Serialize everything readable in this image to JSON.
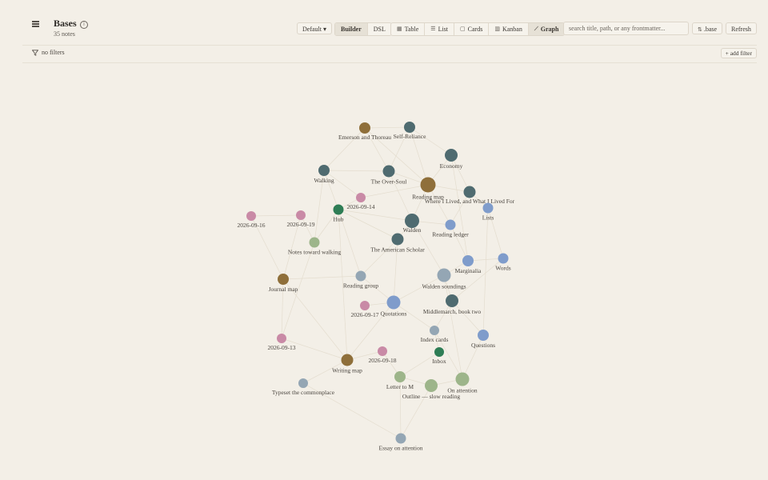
{
  "header": {
    "title": "Bases",
    "note_count": "35 notes"
  },
  "toolbar": {
    "preset_label": "Default ▾",
    "mode_tabs": [
      "Builder",
      "DSL"
    ],
    "active_mode": "Builder",
    "view_tabs": [
      {
        "label": "Table",
        "icon": "table-icon"
      },
      {
        "label": "List",
        "icon": "list-icon"
      },
      {
        "label": "Cards",
        "icon": "cards-icon"
      },
      {
        "label": "Kanban",
        "icon": "kanban-icon"
      },
      {
        "label": "Graph",
        "icon": "graph-icon"
      }
    ],
    "active_view": "Graph",
    "search_placeholder": "search title, path, or any frontmatter...",
    "base_file_label": ".base",
    "refresh_label": "Refresh"
  },
  "filters": {
    "status_text": "no filters",
    "add_filter_label": "+ add filter"
  },
  "colors": {
    "background": "#f3efe7",
    "edge": "#e4ddcf",
    "brown": "#8f6f3a",
    "slate": "#4f6b70",
    "blue": "#7f9ccb",
    "pink": "#c98aa6",
    "green": "#2e7d55",
    "sage": "#9db58a",
    "grey": "#94a6b4"
  },
  "graph": {
    "nodes": [
      {
        "label": "Emerson and Thoreau",
        "color": "brown"
      },
      {
        "label": "Self-Reliance",
        "color": "slate"
      },
      {
        "label": "Economy",
        "color": "slate"
      },
      {
        "label": "Walking",
        "color": "slate"
      },
      {
        "label": "The Over-Soul",
        "color": "slate"
      },
      {
        "label": "Reading map",
        "color": "brown"
      },
      {
        "label": "Where I Lived, and What I Lived For",
        "color": "slate"
      },
      {
        "label": "2026-09-14",
        "color": "pink"
      },
      {
        "label": "Hub",
        "color": "green"
      },
      {
        "label": "Lists",
        "color": "blue"
      },
      {
        "label": "2026-09-16",
        "color": "pink"
      },
      {
        "label": "2026-09-19",
        "color": "pink"
      },
      {
        "label": "Walden",
        "color": "slate"
      },
      {
        "label": "Reading ledger",
        "color": "blue"
      },
      {
        "label": "Notes toward walking",
        "color": "sage"
      },
      {
        "label": "The American Scholar",
        "color": "slate"
      },
      {
        "label": "Marginalia",
        "color": "blue"
      },
      {
        "label": "Words",
        "color": "blue"
      },
      {
        "label": "Journal map",
        "color": "brown"
      },
      {
        "label": "Reading group",
        "color": "grey"
      },
      {
        "label": "Walden soundings",
        "color": "grey"
      },
      {
        "label": "2026-09-17",
        "color": "pink"
      },
      {
        "label": "Quotations",
        "color": "blue"
      },
      {
        "label": "Middlemarch, book two",
        "color": "slate"
      },
      {
        "label": "Index cards",
        "color": "grey"
      },
      {
        "label": "Questions",
        "color": "blue"
      },
      {
        "label": "2026-09-13",
        "color": "pink"
      },
      {
        "label": "Inbox",
        "color": "green"
      },
      {
        "label": "Writing map",
        "color": "brown"
      },
      {
        "label": "2026-09-18",
        "color": "pink"
      },
      {
        "label": "Letter to M",
        "color": "sage"
      },
      {
        "label": "On attention",
        "color": "sage"
      },
      {
        "label": "Outline — slow reading",
        "color": "sage"
      },
      {
        "label": "Typeset the commonplace",
        "color": "grey"
      },
      {
        "label": "Essay on attention",
        "color": "grey"
      }
    ]
  }
}
